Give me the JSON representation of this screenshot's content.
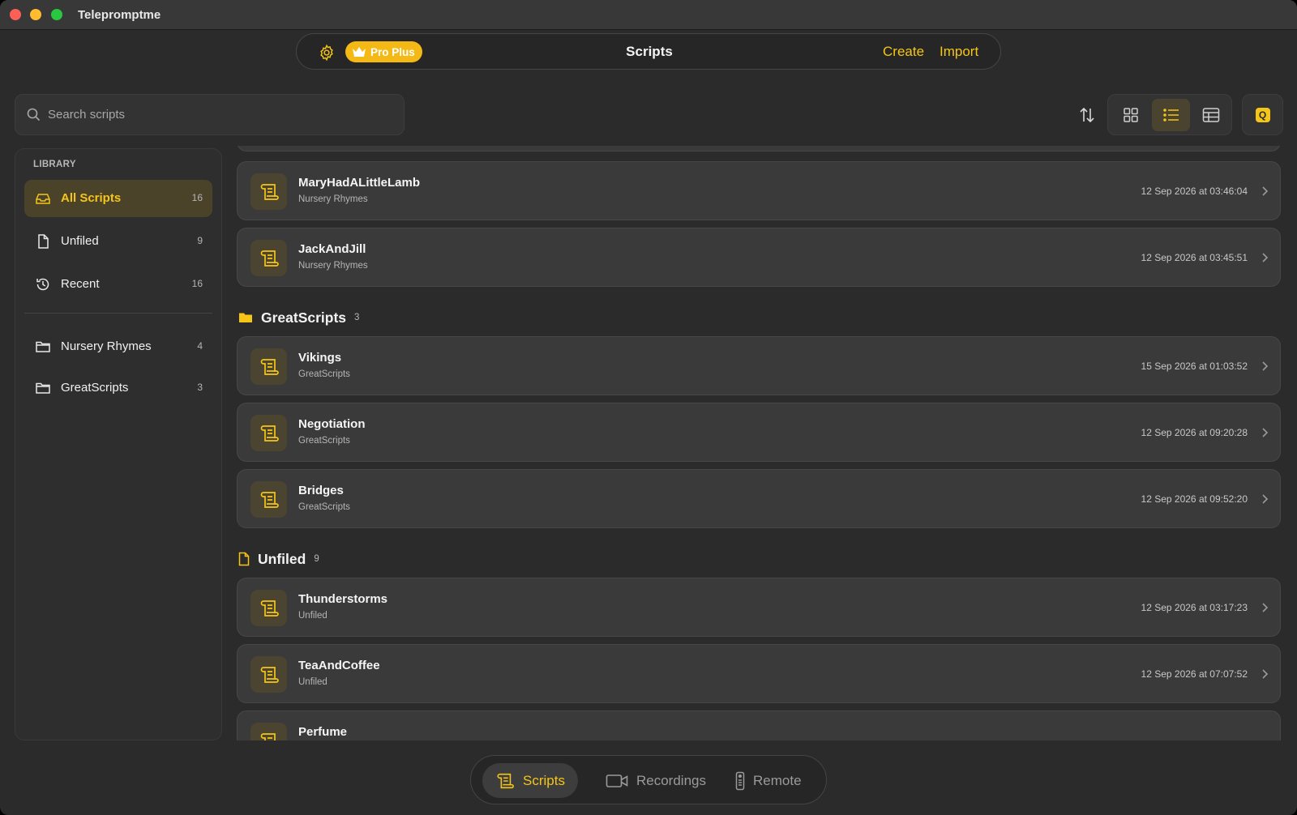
{
  "window": {
    "title": "Telepromptme"
  },
  "toolbar": {
    "badge_label": "Pro Plus",
    "title": "Scripts",
    "create_label": "Create",
    "import_label": "Import"
  },
  "search": {
    "placeholder": "Search scripts",
    "value": ""
  },
  "view_mode": "list",
  "sidebar": {
    "section_label": "LIBRARY",
    "items": [
      {
        "label": "All Scripts",
        "count": "16",
        "icon": "tray-icon",
        "active": true
      },
      {
        "label": "Unfiled",
        "count": "9",
        "icon": "document-icon"
      },
      {
        "label": "Recent",
        "count": "16",
        "icon": "history-icon"
      },
      {
        "label": "Nursery Rhymes",
        "count": "4",
        "icon": "folder-icon"
      },
      {
        "label": "GreatScripts",
        "count": "3",
        "icon": "folder-icon"
      }
    ]
  },
  "sections": {
    "nursery": {
      "rows": [
        {
          "title": "MaryHadALittleLamb",
          "folder": "Nursery Rhymes",
          "date": "12 Sep 2026 at 03:46:04"
        },
        {
          "title": "JackAndJill",
          "folder": "Nursery Rhymes",
          "date": "12 Sep 2026 at 03:45:51"
        }
      ]
    },
    "great": {
      "title": "GreatScripts",
      "count": "3",
      "rows": [
        {
          "title": "Vikings",
          "folder": "GreatScripts",
          "date": "15 Sep 2026 at 01:03:52"
        },
        {
          "title": "Negotiation",
          "folder": "GreatScripts",
          "date": "12 Sep 2026 at 09:20:28"
        },
        {
          "title": "Bridges",
          "folder": "GreatScripts",
          "date": "12 Sep 2026 at 09:52:20"
        }
      ]
    },
    "unfiled": {
      "title": "Unfiled",
      "count": "9",
      "rows": [
        {
          "title": "Thunderstorms",
          "folder": "Unfiled",
          "date": "12 Sep 2026 at 03:17:23"
        },
        {
          "title": "TeaAndCoffee",
          "folder": "Unfiled",
          "date": "12 Sep 2026 at 07:07:52"
        },
        {
          "title": "Perfume",
          "folder": "",
          "date": ""
        }
      ]
    }
  },
  "tabs": [
    {
      "label": "Scripts",
      "icon": "script-icon",
      "active": true
    },
    {
      "label": "Recordings",
      "icon": "video-camera-icon"
    },
    {
      "label": "Remote",
      "icon": "remote-icon"
    }
  ],
  "colors": {
    "accent": "#f5c518",
    "badge": "#f5b915",
    "background": "#2b2b2b"
  }
}
